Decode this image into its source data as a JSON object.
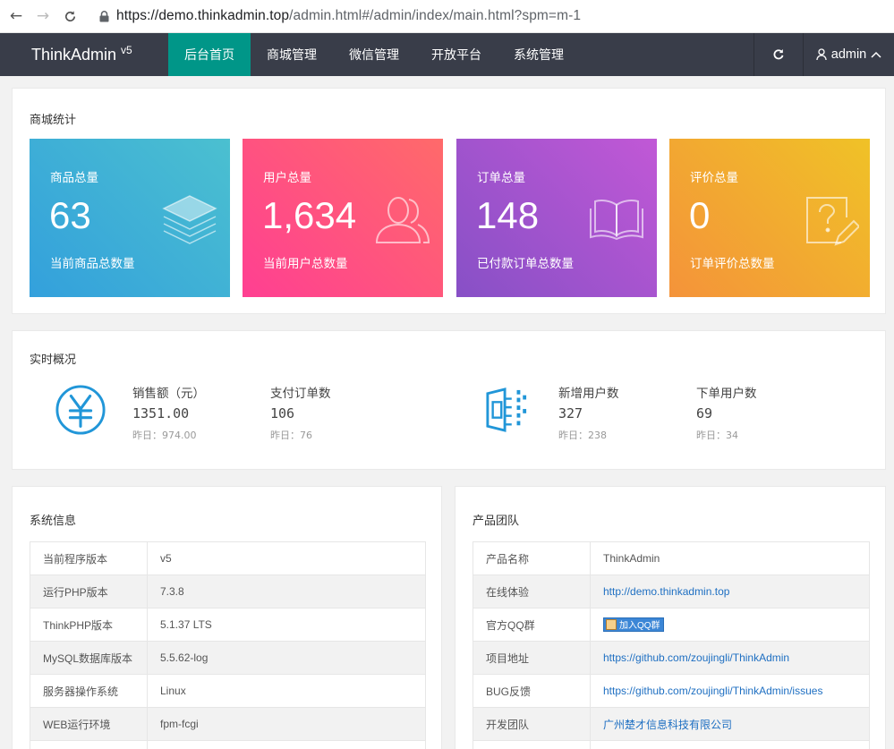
{
  "browser": {
    "url_host": "https://demo.thinkadmin.top",
    "url_path": "/admin.html#/admin/index/main.html?spm=m-1"
  },
  "header": {
    "brand": "ThinkAdmin",
    "brand_sup": "v5",
    "menu": [
      "后台首页",
      "商城管理",
      "微信管理",
      "开放平台",
      "系统管理"
    ],
    "active_index": 0,
    "user": "admin",
    "accent": "#009688",
    "bg": "#393d49"
  },
  "stats": {
    "title": "商城统计",
    "cards": [
      {
        "label": "商品总量",
        "value": "63",
        "sub": "当前商品总数量",
        "icon": "layers-icon"
      },
      {
        "label": "用户总量",
        "value": "1,634",
        "sub": "当前用户总数量",
        "icon": "users-icon"
      },
      {
        "label": "订单总量",
        "value": "148",
        "sub": "已付款订单总数量",
        "icon": "book-icon"
      },
      {
        "label": "评价总量",
        "value": "0",
        "sub": "订单评价总数量",
        "icon": "question-edit-icon"
      }
    ]
  },
  "realtime": {
    "title": "实时概况",
    "items": [
      {
        "label": "销售额（元）",
        "value": "1351.00",
        "yesterday": "昨日：974.00"
      },
      {
        "label": "支付订单数",
        "value": "106",
        "yesterday": "昨日：76"
      },
      {
        "label": "新增用户数",
        "value": "327",
        "yesterday": "昨日：238"
      },
      {
        "label": "下单用户数",
        "value": "69",
        "yesterday": "昨日：34"
      }
    ]
  },
  "sysinfo": {
    "title": "系统信息",
    "rows": [
      {
        "k": "当前程序版本",
        "v": "v5"
      },
      {
        "k": "运行PHP版本",
        "v": "7.3.8"
      },
      {
        "k": "ThinkPHP版本",
        "v": "5.1.37 LTS"
      },
      {
        "k": "MySQL数据库版本",
        "v": "5.5.62-log"
      },
      {
        "k": "服务器操作系统",
        "v": "Linux"
      },
      {
        "k": "WEB运行环境",
        "v": "fpm-fcgi"
      }
    ]
  },
  "team": {
    "title": "产品团队",
    "rows": [
      {
        "k": "产品名称",
        "v": "ThinkAdmin"
      },
      {
        "k": "在线体验",
        "v": "http://demo.thinkadmin.top"
      },
      {
        "k": "官方QQ群",
        "v": "加入QQ群"
      },
      {
        "k": "项目地址",
        "v": "https://github.com/zoujingli/ThinkAdmin"
      },
      {
        "k": "BUG反馈",
        "v": "https://github.com/zoujingli/ThinkAdmin/issues"
      },
      {
        "k": "开发团队",
        "v": "广州楚才信息科技有限公司"
      }
    ]
  }
}
